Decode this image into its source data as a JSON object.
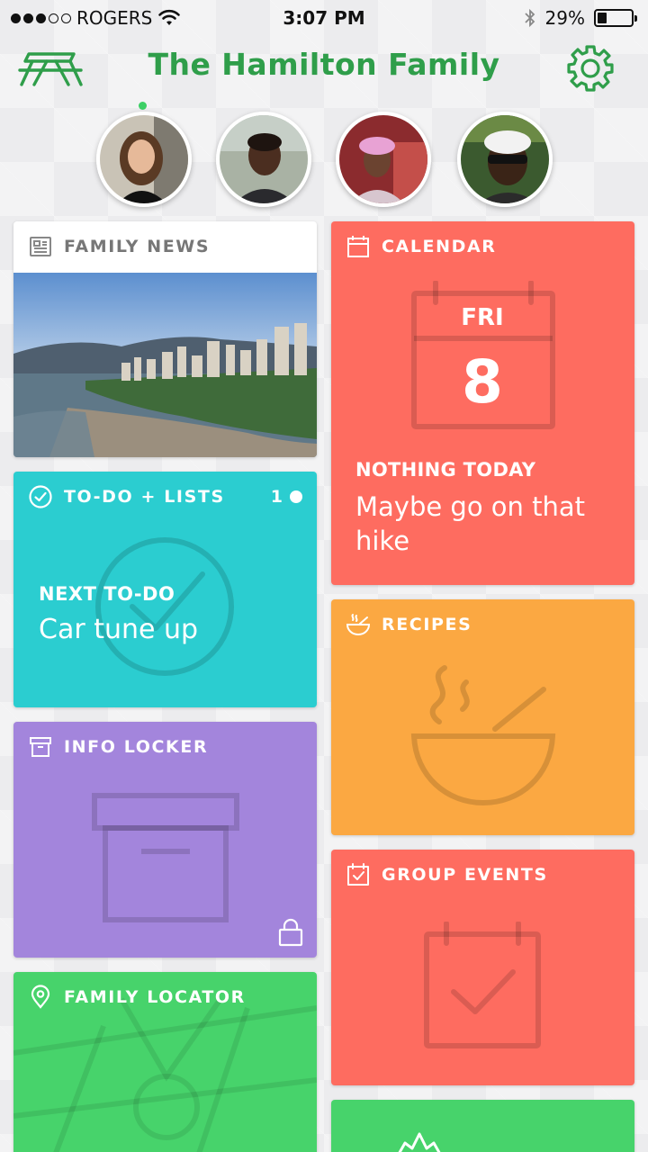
{
  "status_bar": {
    "carrier": "ROGERS",
    "time": "3:07 PM",
    "battery": "29%",
    "signal_bars_filled": 3,
    "signal_bars_total": 5
  },
  "header": {
    "title": "The Hamilton Family",
    "logo_icon": "picnic-table-logo",
    "settings_icon": "gear-icon"
  },
  "members": [
    {
      "name_icon": "avatar-mom",
      "online": true
    },
    {
      "name_icon": "avatar-son",
      "online": false
    },
    {
      "name_icon": "avatar-daughter",
      "online": false
    },
    {
      "name_icon": "avatar-dad",
      "online": false
    }
  ],
  "cards": {
    "family_news": {
      "label": "FAMILY NEWS",
      "icon": "newspaper-icon"
    },
    "todo": {
      "label": "TO-DO + LISTS",
      "icon": "check-circle-icon",
      "count": "1",
      "next_label": "NEXT TO-DO",
      "next_value": "Car tune up"
    },
    "info_locker": {
      "label": "INFO LOCKER",
      "icon": "archive-box-icon"
    },
    "family_locator": {
      "label": "FAMILY LOCATOR",
      "icon": "location-pin-icon"
    },
    "calendar": {
      "label": "CALENDAR",
      "icon": "calendar-icon",
      "day": "FRI",
      "date": "8",
      "status": "NOTHING TODAY",
      "suggestion": "Maybe go on that hike"
    },
    "recipes": {
      "label": "RECIPES",
      "icon": "bowl-icon"
    },
    "group_events": {
      "label": "GROUP EVENTS",
      "icon": "calendar-check-icon"
    }
  },
  "colors": {
    "brand_green": "#2f9e4a",
    "todo": "#2bcdd0",
    "calendar": "#fe6c60",
    "locker": "#a385dc",
    "recipes": "#fba842",
    "locator": "#47d36b"
  }
}
